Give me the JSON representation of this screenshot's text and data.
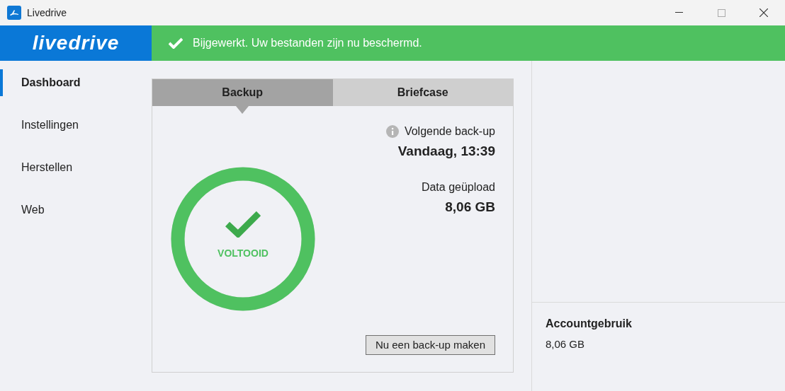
{
  "window": {
    "title": "Livedrive"
  },
  "logo": "livedrive",
  "banner": {
    "text": "Bijgewerkt. Uw bestanden zijn nu beschermd."
  },
  "sidebar": {
    "items": [
      {
        "label": "Dashboard",
        "selected": true
      },
      {
        "label": "Instellingen",
        "selected": false
      },
      {
        "label": "Herstellen",
        "selected": false
      },
      {
        "label": "Web",
        "selected": false
      }
    ]
  },
  "tabs": [
    {
      "label": "Backup",
      "selected": true
    },
    {
      "label": "Briefcase",
      "selected": false
    }
  ],
  "status": {
    "label": "VOLTOOID"
  },
  "next_backup": {
    "label": "Volgende back-up",
    "value": "Vandaag, 13:39"
  },
  "uploaded": {
    "label": "Data geüpload",
    "value": "8,06 GB"
  },
  "backup_button": "Nu een back-up maken",
  "account": {
    "label": "Accountgebruik",
    "value": "8,06 GB"
  }
}
